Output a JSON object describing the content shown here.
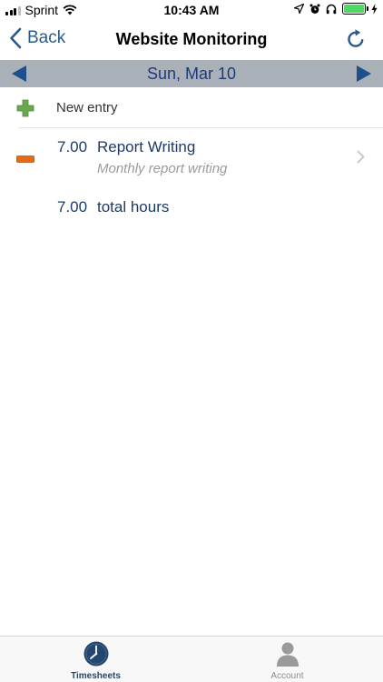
{
  "status_bar": {
    "carrier": "Sprint",
    "time": "10:43 AM"
  },
  "nav": {
    "back_label": "Back",
    "title": "Website Monitoring"
  },
  "date_bar": {
    "date": "Sun, Mar 10"
  },
  "new_entry": {
    "label": "New entry"
  },
  "entries": [
    {
      "hours": "7.00",
      "title": "Report Writing",
      "subtitle": "Monthly report writing"
    }
  ],
  "total": {
    "hours": "7.00",
    "label": "total hours"
  },
  "tabs": [
    {
      "label": "Timesheets",
      "icon": "clock-icon",
      "selected": true
    },
    {
      "label": "Account",
      "icon": "person-icon",
      "selected": false
    }
  ],
  "colors": {
    "accent": "#2a5a8c",
    "date_bar": "#aab0b8",
    "plus": "#6aa84f",
    "minus": "#e06c1a",
    "battery": "#4cd964"
  }
}
